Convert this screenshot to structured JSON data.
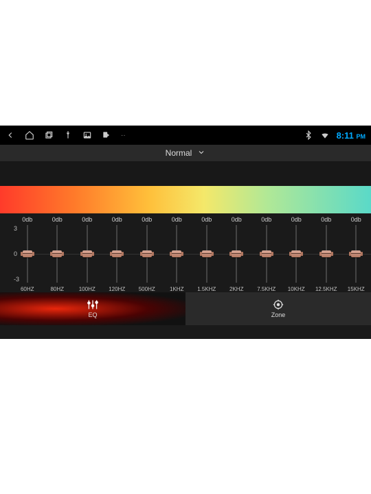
{
  "statusbar": {
    "time": "8:11",
    "ampm": "PM"
  },
  "preset": {
    "label": "Normal"
  },
  "scale": {
    "top": "3",
    "mid": "0",
    "bot": "-3"
  },
  "bands": [
    {
      "db": "0db",
      "freq": "60HZ"
    },
    {
      "db": "0db",
      "freq": "80HZ"
    },
    {
      "db": "0db",
      "freq": "100HZ"
    },
    {
      "db": "0db",
      "freq": "120HZ"
    },
    {
      "db": "0db",
      "freq": "500HZ"
    },
    {
      "db": "0db",
      "freq": "1KHZ"
    },
    {
      "db": "0db",
      "freq": "1.5KHZ"
    },
    {
      "db": "0db",
      "freq": "2KHZ"
    },
    {
      "db": "0db",
      "freq": "7.5KHZ"
    },
    {
      "db": "0db",
      "freq": "10KHZ"
    },
    {
      "db": "0db",
      "freq": "12.5KHZ"
    },
    {
      "db": "0db",
      "freq": "15KHZ"
    }
  ],
  "tabs": {
    "eq": "EQ",
    "zone": "Zone"
  }
}
